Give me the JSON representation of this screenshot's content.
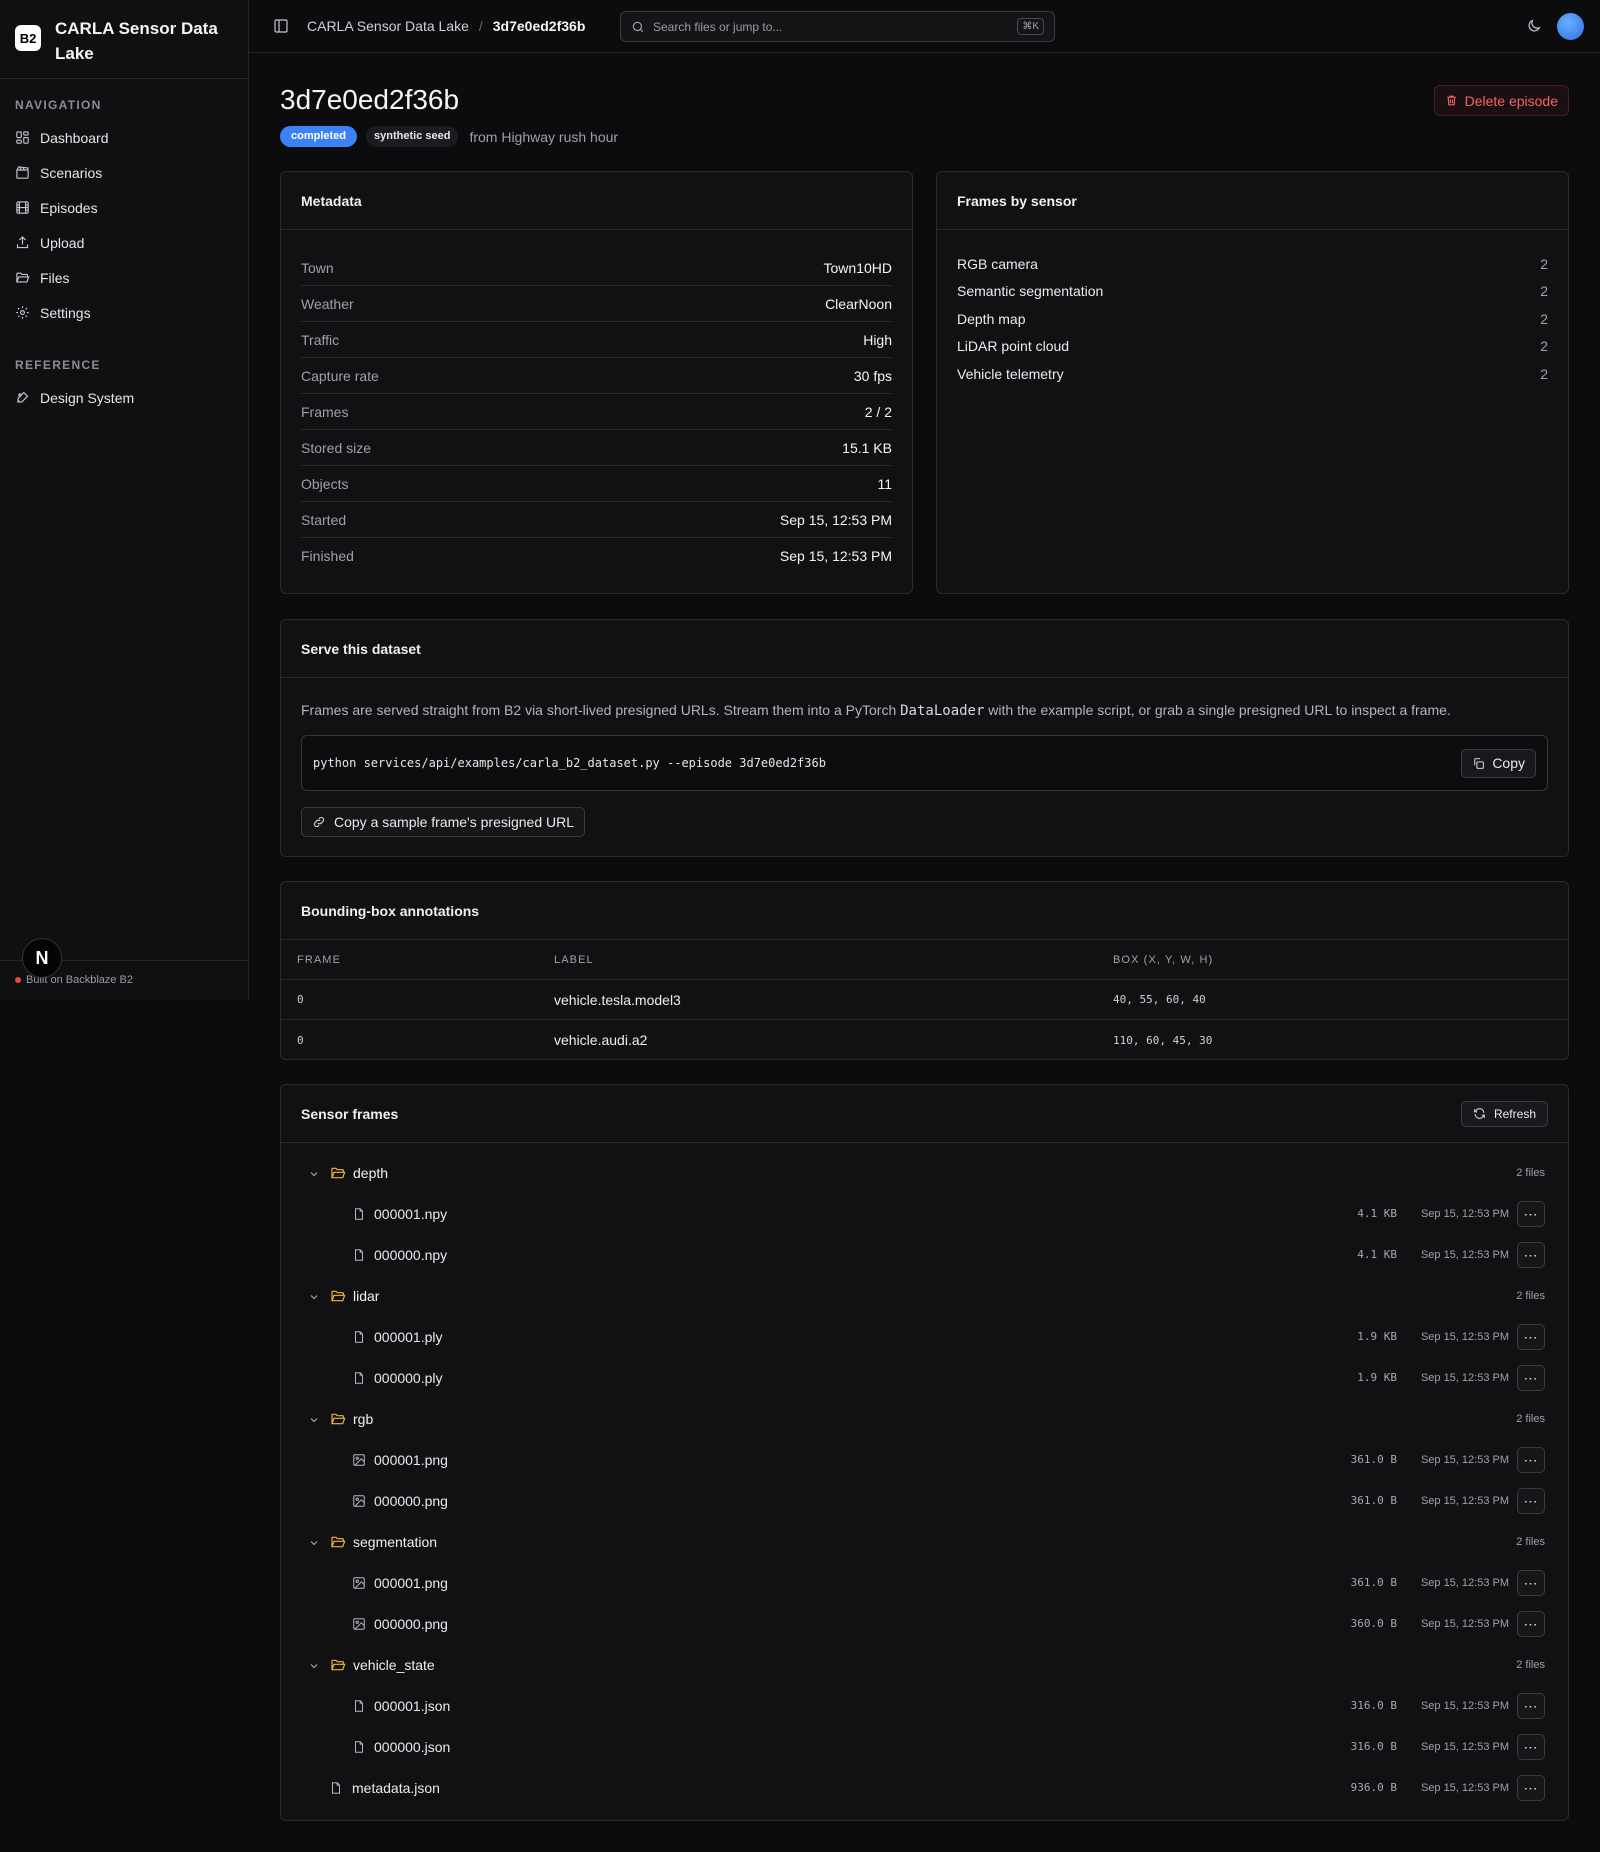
{
  "brand": {
    "logo": "B2",
    "name": "CARLA Sensor Data Lake"
  },
  "sidebar": {
    "nav_heading": "NAVIGATION",
    "nav_items": [
      {
        "label": "Dashboard",
        "icon": "dashboard-icon"
      },
      {
        "label": "Scenarios",
        "icon": "clapperboard-icon"
      },
      {
        "label": "Episodes",
        "icon": "film-icon"
      },
      {
        "label": "Upload",
        "icon": "upload-icon"
      },
      {
        "label": "Files",
        "icon": "folder-open-icon"
      },
      {
        "label": "Settings",
        "icon": "gear-icon"
      }
    ],
    "ref_heading": "REFERENCE",
    "ref_items": [
      {
        "label": "Design System",
        "icon": "palette-icon"
      }
    ],
    "footer": "Built on Backblaze B2",
    "n_badge": "N"
  },
  "topbar": {
    "crumb_root": "CARLA Sensor Data Lake",
    "crumb_sep": "/",
    "crumb_current": "3d7e0ed2f36b",
    "search_placeholder": "Search files or jump to...",
    "search_kbd": "⌘K"
  },
  "episode": {
    "title": "3d7e0ed2f36b",
    "status": "completed",
    "seed_badge": "synthetic seed",
    "from": "from Highway rush hour",
    "delete_label": "Delete episode"
  },
  "metadata": {
    "title": "Metadata",
    "rows": [
      {
        "k": "Town",
        "v": "Town10HD"
      },
      {
        "k": "Weather",
        "v": "ClearNoon"
      },
      {
        "k": "Traffic",
        "v": "High"
      },
      {
        "k": "Capture rate",
        "v": "30 fps"
      },
      {
        "k": "Frames",
        "v": "2 / 2"
      },
      {
        "k": "Stored size",
        "v": "15.1 KB"
      },
      {
        "k": "Objects",
        "v": "11"
      },
      {
        "k": "Started",
        "v": "Sep 15, 12:53 PM"
      },
      {
        "k": "Finished",
        "v": "Sep 15, 12:53 PM"
      }
    ]
  },
  "frames_by_sensor": {
    "title": "Frames by sensor",
    "rows": [
      {
        "k": "RGB camera",
        "v": "2"
      },
      {
        "k": "Semantic segmentation",
        "v": "2"
      },
      {
        "k": "Depth map",
        "v": "2"
      },
      {
        "k": "LiDAR point cloud",
        "v": "2"
      },
      {
        "k": "Vehicle telemetry",
        "v": "2"
      }
    ]
  },
  "serve": {
    "title": "Serve this dataset",
    "desc_pre": "Frames are served straight from B2 via short-lived presigned URLs. Stream them into a PyTorch ",
    "desc_code": "DataLoader",
    "desc_post": " with the example script, or grab a single presigned URL to inspect a frame.",
    "command": "python services/api/examples/carla_b2_dataset.py --episode 3d7e0ed2f36b",
    "copy_label": "Copy",
    "presign_label": "Copy a sample frame's presigned URL"
  },
  "bbox": {
    "title": "Bounding-box annotations",
    "columns": [
      "FRAME",
      "LABEL",
      "BOX (X, Y, W, H)"
    ],
    "rows": [
      {
        "frame": "0",
        "label": "vehicle.tesla.model3",
        "box": "40, 55, 60, 40"
      },
      {
        "frame": "0",
        "label": "vehicle.audi.a2",
        "box": "110, 60, 45, 30"
      }
    ]
  },
  "sensor_frames": {
    "title": "Sensor frames",
    "refresh_label": "Refresh",
    "folders": [
      {
        "name": "depth",
        "count": "2 files",
        "files": [
          {
            "name": "000001.npy",
            "type": "file",
            "size": "4.1 KB",
            "date": "Sep 15, 12:53 PM"
          },
          {
            "name": "000000.npy",
            "type": "file",
            "size": "4.1 KB",
            "date": "Sep 15, 12:53 PM"
          }
        ]
      },
      {
        "name": "lidar",
        "count": "2 files",
        "files": [
          {
            "name": "000001.ply",
            "type": "file",
            "size": "1.9 KB",
            "date": "Sep 15, 12:53 PM"
          },
          {
            "name": "000000.ply",
            "type": "file",
            "size": "1.9 KB",
            "date": "Sep 15, 12:53 PM"
          }
        ]
      },
      {
        "name": "rgb",
        "count": "2 files",
        "files": [
          {
            "name": "000001.png",
            "type": "image",
            "size": "361.0 B",
            "date": "Sep 15, 12:53 PM"
          },
          {
            "name": "000000.png",
            "type": "image",
            "size": "361.0 B",
            "date": "Sep 15, 12:53 PM"
          }
        ]
      },
      {
        "name": "segmentation",
        "count": "2 files",
        "files": [
          {
            "name": "000001.png",
            "type": "image",
            "size": "361.0 B",
            "date": "Sep 15, 12:53 PM"
          },
          {
            "name": "000000.png",
            "type": "image",
            "size": "360.0 B",
            "date": "Sep 15, 12:53 PM"
          }
        ]
      },
      {
        "name": "vehicle_state",
        "count": "2 files",
        "files": [
          {
            "name": "000001.json",
            "type": "file",
            "size": "316.0 B",
            "date": "Sep 15, 12:53 PM"
          },
          {
            "name": "000000.json",
            "type": "file",
            "size": "316.0 B",
            "date": "Sep 15, 12:53 PM"
          }
        ]
      }
    ],
    "root_files": [
      {
        "name": "metadata.json",
        "type": "file",
        "size": "936.0 B",
        "date": "Sep 15, 12:53 PM"
      }
    ]
  },
  "colors": {
    "accent": "#3b82f6",
    "danger": "#f06470",
    "folder": "#f0b43c"
  }
}
